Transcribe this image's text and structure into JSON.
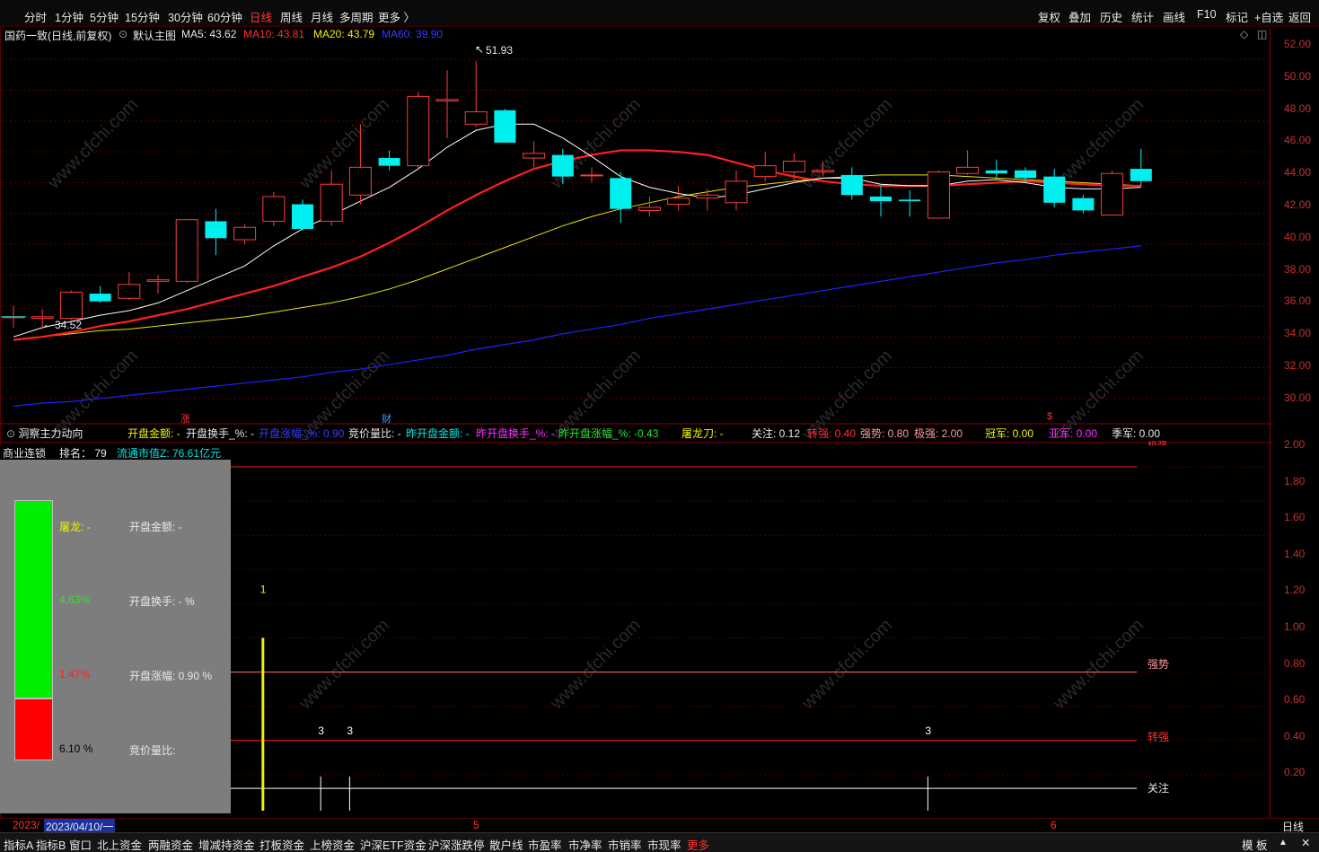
{
  "periods": [
    "分时",
    "1分钟",
    "5分钟",
    "15分钟",
    "30分钟",
    "60分钟",
    "日线",
    "周线",
    "月线",
    "多周期",
    "更多 〉"
  ],
  "active_period": "日线",
  "right_tools": [
    "复权",
    "叠加",
    "历史",
    "统计",
    "画线",
    "F10",
    "标记",
    "+自选",
    "返回"
  ],
  "main_header": {
    "stock": "国药一致(日线,前复权)",
    "template": "默认主图",
    "ma5": "MA5: 43.62",
    "ma10": "MA10: 43.81",
    "ma20": "MA20: 43.79",
    "ma60": "MA60: 39.90"
  },
  "high_label": "51.93",
  "low_label": "34.52",
  "price_axis": [
    "52.00",
    "50.00",
    "48.00",
    "46.00",
    "44.00",
    "42.00",
    "40.00",
    "38.00",
    "36.00",
    "34.00",
    "32.00",
    "30.00"
  ],
  "markers": {
    "zhang": "涨",
    "cai": "财",
    "dollar": "$"
  },
  "indicator_header": {
    "name": "洞察主力动向",
    "kaipan_jine": "开盘金额: -",
    "kaipan_huanshou": "开盘换手_%: -",
    "kaipan_zhangfu": "开盘涨幅_%: 0.90",
    "jingjia_liangbi": "竞价量比: -",
    "zuo_kaipan_jine": "昨开盘金额: -",
    "zuo_kaipan_huanshou": "昨开盘换手_%: -",
    "zuo_kaipan_zhangfu": "昨开盘涨幅_%: -0.43",
    "tulong": "屠龙刀: -",
    "guanzhu": "关注: 0.12",
    "zhuanqiang": "转强: 0.40",
    "qiangshi": "强势: 0.80",
    "jiqiang": "极强: 2.00",
    "guanjun": "冠军: 0.00",
    "yajun": "亚军: 0.00",
    "jijun": "季军: 0.00"
  },
  "sector_panel": {
    "sector": "商业连锁",
    "rank": "排名： 79",
    "mktcap": "流通市值Z: 76.61亿元",
    "tulong": "屠龙: -",
    "kaipan_jine": "开盘金额: -",
    "pct1": "4.63%",
    "kaipan_huanshou": "开盘换手: - %",
    "pct2": "1.47%",
    "kaipan_zhangfu": "开盘涨幅: 0.90 %",
    "pct3": "6.10 %",
    "jingjia": "竞价量比:"
  },
  "indicator_axis": [
    "2.00",
    "1.80",
    "1.60",
    "1.40",
    "1.20",
    "1.00",
    "0.80",
    "0.60",
    "0.40",
    "0.20"
  ],
  "ref_lines": {
    "qiangshi": "强势",
    "zhuanqiang": "转强",
    "guanzhu": "关注",
    "jiqiang": "极强"
  },
  "bar_labels": {
    "one": "1",
    "three": "3"
  },
  "bottom": {
    "year": "2023/",
    "date": "2023/04/10/一",
    "m5": "5",
    "m6": "6",
    "period": "日线"
  },
  "tabs": [
    "指标A",
    "指标B",
    "窗口",
    "北上资金",
    "两融资金",
    "增减持资金",
    "打板资金",
    "上榜资金",
    "沪深ETF资金",
    "沪深涨跌停",
    "散户线",
    "市盈率",
    "市净率",
    "市销率",
    "市现率",
    "更多"
  ],
  "tab_right": [
    "模 板",
    "▲",
    "✕"
  ],
  "watermark": "www.cfchi.com",
  "colors": {
    "up": "#ff3b3b",
    "down": "#00f0f0",
    "ma5": "#ffffff",
    "ma10": "#ff2020",
    "ma20": "#e8e800",
    "ma60": "#2020ff"
  },
  "chart_data": {
    "type": "candlestick",
    "title": "国药一致(日线,前复权)",
    "ylim": [
      29.0,
      53.0
    ],
    "candles": [
      {
        "o": 35.3,
        "h": 36.0,
        "l": 34.6,
        "c": 35.3
      },
      {
        "o": 35.2,
        "h": 35.8,
        "l": 34.5,
        "c": 35.3
      },
      {
        "o": 35.2,
        "h": 37.0,
        "l": 35.1,
        "c": 36.9
      },
      {
        "o": 36.8,
        "h": 37.3,
        "l": 36.2,
        "c": 36.3
      },
      {
        "o": 36.5,
        "h": 38.2,
        "l": 36.4,
        "c": 37.4
      },
      {
        "o": 37.6,
        "h": 38.0,
        "l": 36.8,
        "c": 37.7
      },
      {
        "o": 37.6,
        "h": 41.6,
        "l": 37.5,
        "c": 41.6
      },
      {
        "o": 41.5,
        "h": 42.3,
        "l": 39.3,
        "c": 40.4
      },
      {
        "o": 40.3,
        "h": 41.3,
        "l": 40.0,
        "c": 41.1
      },
      {
        "o": 41.5,
        "h": 43.4,
        "l": 41.2,
        "c": 43.1
      },
      {
        "o": 42.6,
        "h": 42.9,
        "l": 40.9,
        "c": 41.0
      },
      {
        "o": 41.5,
        "h": 44.8,
        "l": 41.2,
        "c": 43.9
      },
      {
        "o": 43.2,
        "h": 47.8,
        "l": 42.6,
        "c": 45.0
      },
      {
        "o": 45.6,
        "h": 46.1,
        "l": 44.8,
        "c": 45.1
      },
      {
        "o": 45.1,
        "h": 49.9,
        "l": 44.9,
        "c": 49.6
      },
      {
        "o": 49.3,
        "h": 51.3,
        "l": 46.9,
        "c": 49.4
      },
      {
        "o": 47.8,
        "h": 51.9,
        "l": 47.6,
        "c": 48.6
      },
      {
        "o": 48.7,
        "h": 48.8,
        "l": 46.6,
        "c": 46.6
      },
      {
        "o": 45.6,
        "h": 46.7,
        "l": 45.0,
        "c": 45.9
      },
      {
        "o": 45.8,
        "h": 46.2,
        "l": 43.9,
        "c": 44.4
      },
      {
        "o": 44.5,
        "h": 45.0,
        "l": 44.0,
        "c": 44.5
      },
      {
        "o": 44.3,
        "h": 44.7,
        "l": 41.4,
        "c": 42.3
      },
      {
        "o": 42.2,
        "h": 43.1,
        "l": 41.8,
        "c": 42.4
      },
      {
        "o": 42.6,
        "h": 43.8,
        "l": 42.2,
        "c": 43.0
      },
      {
        "o": 43.0,
        "h": 43.6,
        "l": 42.2,
        "c": 43.2
      },
      {
        "o": 42.7,
        "h": 44.8,
        "l": 42.2,
        "c": 44.1
      },
      {
        "o": 44.4,
        "h": 46.0,
        "l": 44.1,
        "c": 45.1
      },
      {
        "o": 44.7,
        "h": 45.9,
        "l": 44.0,
        "c": 45.4
      },
      {
        "o": 44.7,
        "h": 45.4,
        "l": 44.4,
        "c": 44.8
      },
      {
        "o": 44.5,
        "h": 45.0,
        "l": 42.9,
        "c": 43.2
      },
      {
        "o": 43.1,
        "h": 43.8,
        "l": 41.8,
        "c": 42.8
      },
      {
        "o": 42.9,
        "h": 43.5,
        "l": 41.8,
        "c": 42.8
      },
      {
        "o": 41.7,
        "h": 44.8,
        "l": 41.7,
        "c": 44.7
      },
      {
        "o": 44.6,
        "h": 46.1,
        "l": 44.5,
        "c": 45.0
      },
      {
        "o": 44.8,
        "h": 45.5,
        "l": 44.3,
        "c": 44.6
      },
      {
        "o": 44.8,
        "h": 45.0,
        "l": 44.0,
        "c": 44.3
      },
      {
        "o": 44.4,
        "h": 44.9,
        "l": 42.4,
        "c": 42.7
      },
      {
        "o": 43.0,
        "h": 43.2,
        "l": 42.0,
        "c": 42.2
      },
      {
        "o": 41.9,
        "h": 44.8,
        "l": 41.9,
        "c": 44.6
      },
      {
        "o": 44.9,
        "h": 46.2,
        "l": 43.8,
        "c": 44.1
      }
    ],
    "ma5": [
      34.0,
      34.6,
      35.0,
      35.4,
      35.7,
      36.2,
      37.0,
      37.8,
      38.6,
      39.9,
      41.0,
      41.9,
      42.8,
      43.7,
      44.9,
      46.3,
      47.4,
      47.8,
      47.8,
      46.9,
      45.7,
      44.4,
      43.7,
      43.3,
      43.0,
      43.2,
      43.6,
      44.0,
      44.3,
      44.3,
      43.9,
      43.8,
      43.8,
      44.1,
      44.2,
      44.0,
      43.7,
      43.6,
      43.6,
      43.7
    ],
    "ma10": [
      33.8,
      34.0,
      34.3,
      34.7,
      35.0,
      35.4,
      35.8,
      36.3,
      36.8,
      37.3,
      37.9,
      38.5,
      39.2,
      40.1,
      41.1,
      42.2,
      43.2,
      44.1,
      44.9,
      45.4,
      45.8,
      46.1,
      46.1,
      46.0,
      45.8,
      45.3,
      44.8,
      44.4,
      44.1,
      43.9,
      43.8,
      43.8,
      43.8,
      43.9,
      44.0,
      44.1,
      44.0,
      43.9,
      43.8,
      43.8
    ],
    "ma20": [
      33.8,
      34.0,
      34.2,
      34.4,
      34.5,
      34.7,
      34.9,
      35.1,
      35.3,
      35.6,
      35.9,
      36.2,
      36.6,
      37.1,
      37.7,
      38.4,
      39.1,
      39.8,
      40.5,
      41.2,
      41.8,
      42.3,
      42.7,
      43.1,
      43.4,
      43.7,
      43.9,
      44.1,
      44.3,
      44.4,
      44.5,
      44.5,
      44.5,
      44.4,
      44.3,
      44.2,
      44.1,
      44.0,
      43.9,
      43.8
    ],
    "ma60": [
      29.5,
      29.7,
      29.8,
      30.0,
      30.2,
      30.4,
      30.6,
      30.8,
      31.0,
      31.2,
      31.4,
      31.7,
      31.9,
      32.2,
      32.5,
      32.8,
      33.2,
      33.5,
      33.8,
      34.2,
      34.5,
      34.8,
      35.2,
      35.5,
      35.8,
      36.1,
      36.4,
      36.7,
      37.0,
      37.3,
      37.6,
      37.9,
      38.2,
      38.5,
      38.8,
      39.0,
      39.3,
      39.5,
      39.7,
      39.9
    ],
    "indicator": {
      "ylim": [
        0.0,
        2.1
      ],
      "guanzhu": 0.12,
      "zhuanqiang": 0.4,
      "qiangshi": 0.8,
      "jiqiang": 2.0,
      "spikes": [
        {
          "i": 6,
          "v": 1.0,
          "label": "1",
          "color": "#f0f000"
        },
        {
          "i": 9,
          "v": 1.0,
          "label": "1",
          "color": "#f0f000"
        },
        {
          "i": 11,
          "v": 0.12,
          "label": "3",
          "color": "#ffffff"
        },
        {
          "i": 12,
          "v": 0.12,
          "label": "3",
          "color": "#ffffff"
        },
        {
          "i": 32,
          "v": 0.12,
          "label": "3",
          "color": "#ffffff"
        }
      ]
    }
  }
}
